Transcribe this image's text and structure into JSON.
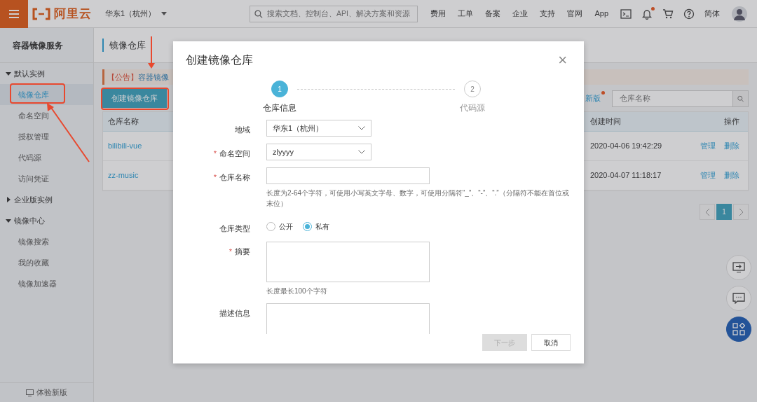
{
  "topbar": {
    "logo": "阿里云",
    "region": "华东1（杭州）",
    "search": {
      "placeholder": "搜索文档、控制台、API、解决方案和资源"
    },
    "links": [
      "费用",
      "工单",
      "备案",
      "企业",
      "支持",
      "官网",
      "App"
    ],
    "icons": [
      {
        "kind": "terminal",
        "dot": false
      },
      {
        "kind": "bell",
        "dot": true
      },
      {
        "kind": "cart",
        "dot": false
      },
      {
        "kind": "help",
        "dot": false
      }
    ],
    "language": "简体"
  },
  "sidebar": {
    "title": "容器镜像服务",
    "groups": [
      {
        "label": "默认实例",
        "expanded": true,
        "children": [
          {
            "label": "镜像仓库",
            "selected": true
          },
          {
            "label": "命名空间",
            "selected": false
          },
          {
            "label": "授权管理",
            "selected": false
          },
          {
            "label": "代码源",
            "selected": false
          },
          {
            "label": "访问凭证",
            "selected": false
          }
        ]
      },
      {
        "label": "企业版实例",
        "expanded": false
      },
      {
        "label": "镜像中心",
        "expanded": true,
        "children": [
          {
            "label": "镜像搜索",
            "selected": false
          },
          {
            "label": "我的收藏",
            "selected": false
          },
          {
            "label": "镜像加速器",
            "selected": false
          }
        ]
      }
    ],
    "footer": "体验新版"
  },
  "main": {
    "title": "镜像仓库",
    "notice": {
      "tag": "【公告】",
      "text": "容器镜像"
    },
    "create_button": "创建镜像仓库",
    "new_version": {
      "label": "新版",
      "dot": true
    },
    "search": {
      "placeholder": "仓库名称"
    },
    "table": {
      "columns": [
        "仓库名称",
        "创建时间",
        "操作"
      ],
      "rows": [
        {
          "name": "bilibili-vue",
          "created": "2020-04-06 19:42:29",
          "actions": [
            "管理",
            "删除"
          ]
        },
        {
          "name": "zz-music",
          "created": "2020-04-07 11:18:17",
          "actions": [
            "管理",
            "删除"
          ]
        }
      ]
    },
    "pagination": [
      {
        "label": "1",
        "selected": true
      }
    ]
  },
  "dialog": {
    "title": "创建镜像仓库",
    "close": "×",
    "steps": [
      {
        "number": "1",
        "label": "仓库信息",
        "selected": true
      },
      {
        "number": "2",
        "label": "代码源",
        "selected": false
      }
    ],
    "fields": [
      {
        "kind": "select",
        "label": "地域",
        "value": "华东1（杭州）"
      },
      {
        "kind": "select",
        "label": "命名空间",
        "mark": "*",
        "value": "zlyyyy"
      },
      {
        "kind": "input",
        "label": "仓库名称",
        "mark": "*",
        "hint": "长度为2-64个字符，可使用小写英文字母、数字，可使用分隔符“_”、“-”、“.”（分隔符不能在首位或末位）"
      },
      {
        "kind": "radio",
        "label": "仓库类型",
        "options": [
          {
            "label": "公开",
            "checked": false
          },
          {
            "label": "私有",
            "checked": true
          }
        ]
      },
      {
        "kind": "textarea",
        "label": "摘要",
        "mark": "*",
        "hint": "长度最长100个字符"
      },
      {
        "kind": "textarea",
        "label": "描述信息"
      }
    ],
    "buttons": [
      {
        "label": "下一步",
        "disabled": true
      },
      {
        "label": "取消",
        "disabled": false
      }
    ]
  }
}
